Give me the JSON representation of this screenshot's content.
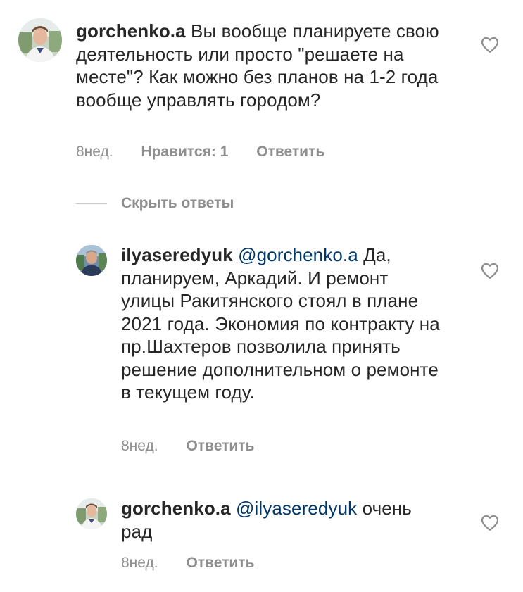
{
  "comments": [
    {
      "username": "gorchenko.a",
      "mention": "",
      "text": "Вы вообще планируете свою деятельность или просто \"решаете на месте\"? Как можно без планов на 1-2 года вообще управлять городом?",
      "time": "8нед.",
      "likes": "Нравится: 1",
      "reply": "Ответить",
      "avatar_icon": "user-avatar-young-man",
      "like_icon": "heart-outline-icon"
    },
    {
      "username": "ilyaseredyuk",
      "mention": "@gorchenko.a",
      "text": "Да, планируем, Аркадий. И ремонт улицы Ракитянского стоял в плане 2021 года. Экономия по контракту на пр.Шахтеров позволила принять решение дополнительном о ремонте в текущем году.",
      "time": "8нед.",
      "reply": "Ответить",
      "avatar_icon": "user-avatar-man",
      "like_icon": "heart-outline-icon"
    },
    {
      "username": "gorchenko.a",
      "mention": "@ilyaseredyuk",
      "text": "очень рад",
      "time": "8нед.",
      "reply": "Ответить",
      "avatar_icon": "user-avatar-young-man",
      "like_icon": "heart-outline-icon"
    }
  ],
  "hide_replies_label": "Скрыть ответы",
  "colors": {
    "text": "#262626",
    "secondary": "#8e8e8e",
    "mention": "#00376b",
    "divider": "#c7c7c7"
  }
}
